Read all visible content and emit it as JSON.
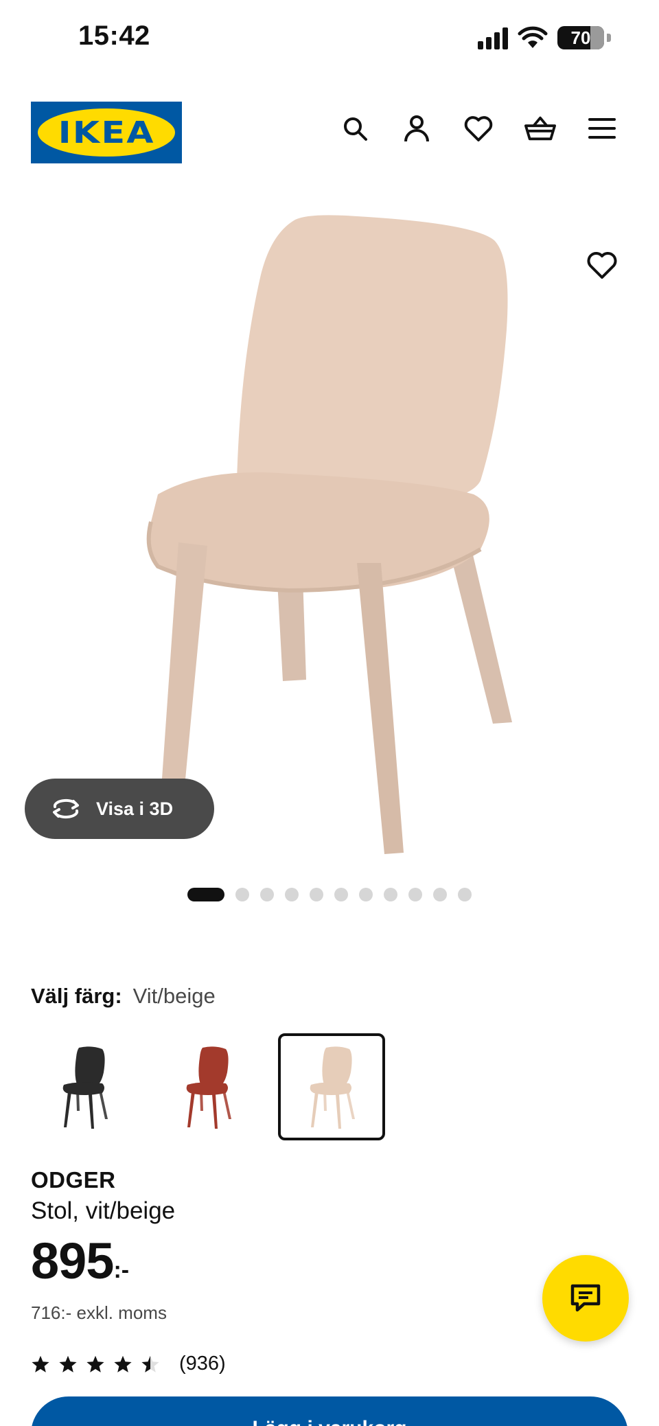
{
  "status_bar": {
    "time": "15:42",
    "battery_percent": "70",
    "battery_level": 0.7,
    "icons": [
      "signal-icon",
      "wifi-icon",
      "battery-icon"
    ]
  },
  "header": {
    "logo_text": "IKEA",
    "icons": [
      "search-icon",
      "account-icon",
      "heart-icon",
      "basket-icon",
      "menu-icon"
    ]
  },
  "gallery": {
    "view_3d_label": "Visa i 3D",
    "total_images": 11,
    "active_index": 0
  },
  "color": {
    "label": "Välj färg:",
    "selected_value": "Vit/beige",
    "options": [
      {
        "name": "black",
        "color": "#2b2b2b",
        "selected": false
      },
      {
        "name": "red",
        "color": "#a33a2c",
        "selected": false
      },
      {
        "name": "white-beige",
        "color": "#e6cdb9",
        "selected": true
      }
    ]
  },
  "product": {
    "name": "ODGER",
    "description": "Stol, vit/beige",
    "price": "895",
    "price_suffix": ":-",
    "price_excl_vat": "716:- exkl. moms",
    "rating": 4.5,
    "review_count": "(936)"
  },
  "cart": {
    "add_label": "Lägg i varukorg"
  },
  "colors": {
    "ikea_blue": "#0058a3",
    "ikea_yellow": "#ffdb00",
    "chair_beige": "#e6cdb9"
  }
}
